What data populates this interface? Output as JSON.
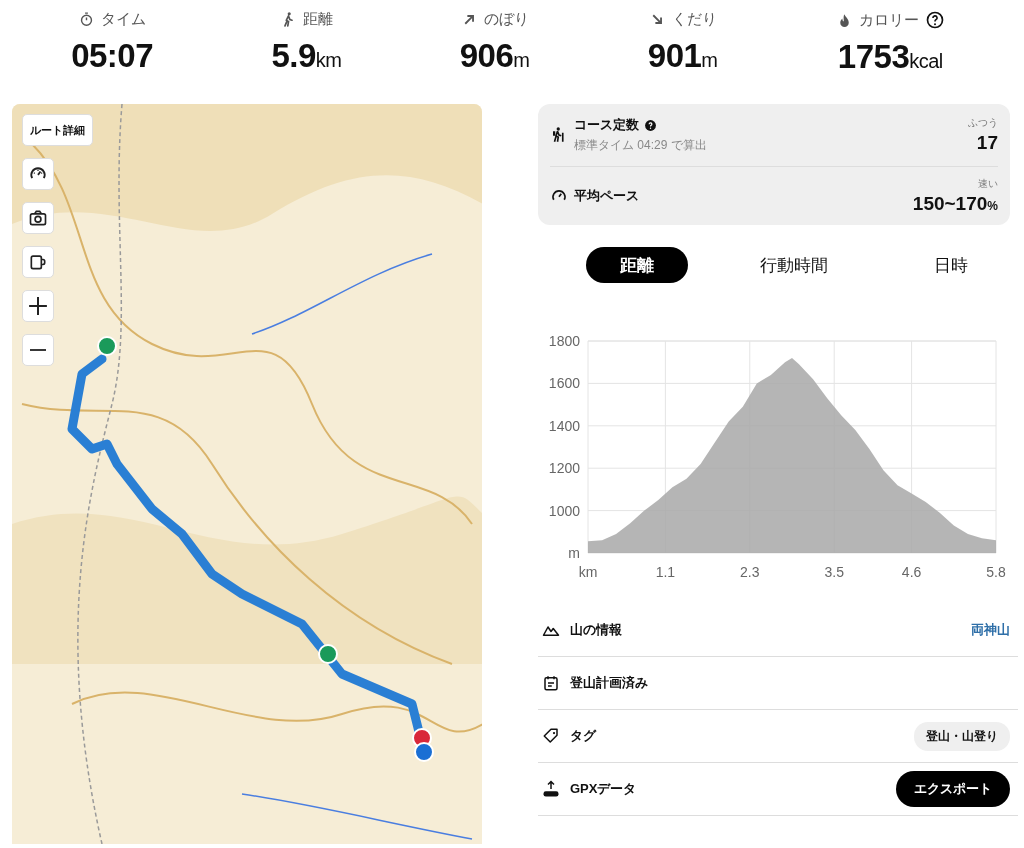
{
  "stats": [
    {
      "kind": "time",
      "label": "タイム",
      "value": "05:07",
      "help": false
    },
    {
      "kind": "distance",
      "label": "距離",
      "value": "5.9",
      "unit": "km",
      "help": false
    },
    {
      "kind": "ascent",
      "label": "のぼり",
      "value": "906",
      "unit": "m",
      "help": false
    },
    {
      "kind": "descent",
      "label": "くだり",
      "value": "901",
      "unit": "m",
      "help": false
    },
    {
      "kind": "calorie",
      "label": "カロリー",
      "value": "1753",
      "unit": "kcal",
      "help": true
    }
  ],
  "map": {
    "route_button": "ルート詳細",
    "controls": [
      {
        "kind": "speed"
      },
      {
        "kind": "camera"
      },
      {
        "kind": "mug"
      },
      {
        "kind": "zoom-in"
      },
      {
        "kind": "zoom-out"
      }
    ]
  },
  "course_card": [
    {
      "kind": "course",
      "label": "コース定数",
      "help": true,
      "sub": "標準タイム 04:29 で算出",
      "rating": "ふつう",
      "value": "17"
    },
    {
      "kind": "pace",
      "label": "平均ペース",
      "help": false,
      "rating": "速い",
      "value": "150~170",
      "unit": "%"
    }
  ],
  "tabs": [
    {
      "label": "距離",
      "selected": true
    },
    {
      "label": "行動時間",
      "selected": false
    },
    {
      "label": "日時",
      "selected": false
    }
  ],
  "chart_data": {
    "type": "area",
    "x": [
      0,
      0.2,
      0.4,
      0.6,
      0.8,
      1.0,
      1.2,
      1.4,
      1.6,
      1.8,
      2.0,
      2.2,
      2.4,
      2.6,
      2.8,
      2.9,
      3.0,
      3.2,
      3.4,
      3.6,
      3.8,
      4.0,
      4.2,
      4.4,
      4.6,
      4.8,
      5.0,
      5.2,
      5.4,
      5.6,
      5.8
    ],
    "grid": true,
    "series": [
      {
        "color": "#a8a8a8",
        "values": [
          855,
          860,
          890,
          940,
          1000,
          1050,
          1110,
          1150,
          1220,
          1320,
          1420,
          1490,
          1600,
          1640,
          1700,
          1720,
          1690,
          1620,
          1530,
          1450,
          1380,
          1290,
          1190,
          1120,
          1080,
          1040,
          990,
          930,
          890,
          870,
          860
        ]
      }
    ],
    "xlim": [
      0,
      5.8
    ],
    "ylim": [
      800,
      1800
    ],
    "xticks": [
      {
        "value": 0,
        "label": "km"
      },
      {
        "value": 1.1,
        "label": "1.1"
      },
      {
        "value": 2.3,
        "label": "2.3"
      },
      {
        "value": 3.5,
        "label": "3.5"
      },
      {
        "value": 4.6,
        "label": "4.6"
      },
      {
        "value": 5.8,
        "label": "5.8"
      }
    ],
    "yticks": [
      {
        "value": 800,
        "label": "m"
      },
      {
        "value": 1000,
        "label": "1000"
      },
      {
        "value": 1200,
        "label": "1200"
      },
      {
        "value": 1400,
        "label": "1400"
      },
      {
        "value": 1600,
        "label": "1600"
      },
      {
        "value": 1800,
        "label": "1800"
      }
    ]
  },
  "info_rows": [
    {
      "kind": "mountain",
      "label": "山の情報",
      "value": "両神山"
    },
    {
      "kind": "plan",
      "label": "登山計画済み"
    },
    {
      "kind": "tag",
      "label": "タグ",
      "value": "登山・山登り"
    },
    {
      "kind": "gpx",
      "label": "GPXデータ",
      "value": "エクスポート"
    }
  ]
}
